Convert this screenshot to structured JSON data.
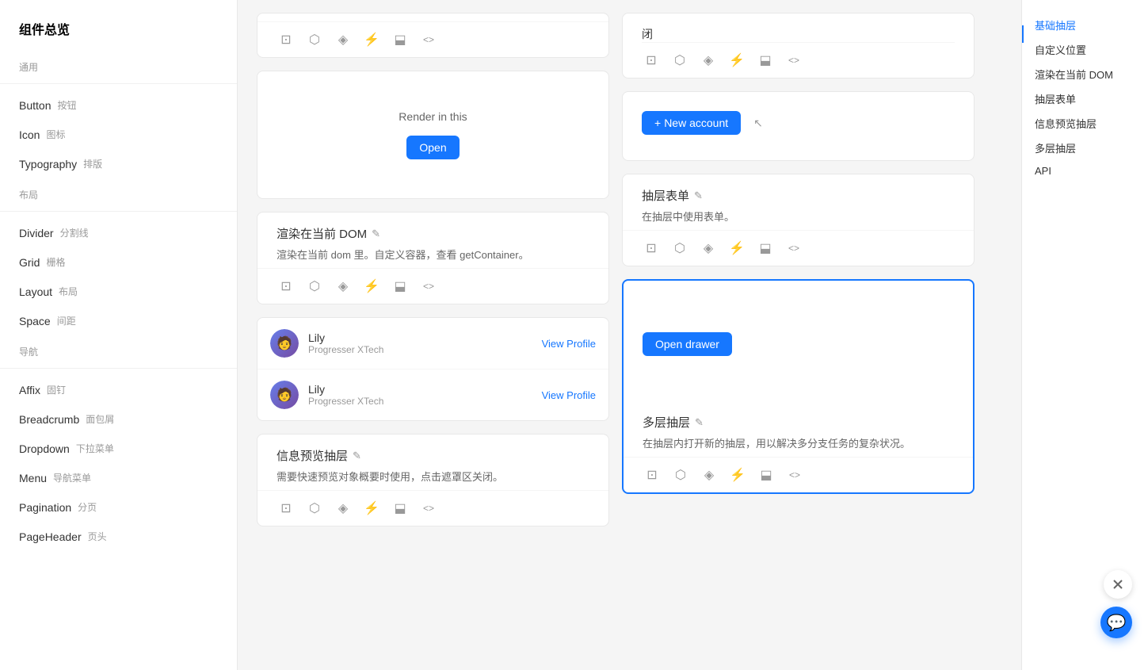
{
  "sidebar": {
    "title": "组件总览",
    "sections": [
      {
        "label": "通用",
        "items": [
          {
            "en": "Button",
            "zh": "按钮"
          },
          {
            "en": "Icon",
            "zh": "图标"
          },
          {
            "en": "Typography",
            "zh": "排版"
          }
        ]
      },
      {
        "label": "布局",
        "items": [
          {
            "en": "Divider",
            "zh": "分割线"
          },
          {
            "en": "Grid",
            "zh": "栅格"
          },
          {
            "en": "Layout",
            "zh": "布局"
          },
          {
            "en": "Space",
            "zh": "间距"
          }
        ]
      },
      {
        "label": "导航",
        "items": [
          {
            "en": "Affix",
            "zh": "固钉"
          },
          {
            "en": "Breadcrumb",
            "zh": "面包屑"
          },
          {
            "en": "Dropdown",
            "zh": "下拉菜单"
          },
          {
            "en": "Menu",
            "zh": "导航菜单"
          },
          {
            "en": "Pagination",
            "zh": "分页"
          },
          {
            "en": "PageHeader",
            "zh": "页头"
          }
        ]
      }
    ]
  },
  "main": {
    "left_column": [
      {
        "id": "render-demo",
        "demo_text": "Render in this",
        "button_label": "Open"
      },
      {
        "id": "render-dom",
        "title": "渲染在当前 DOM",
        "desc": "渲染在当前 dom 里。自定义容器，查看 getContainer。"
      },
      {
        "id": "user-list",
        "users": [
          {
            "name": "Lily",
            "company": "Progresser XTech",
            "link": "View Profile"
          },
          {
            "name": "Lily",
            "company": "Progresser XTech",
            "link": "View Profile"
          }
        ]
      },
      {
        "id": "preview-drawer",
        "title": "信息预览抽层",
        "desc": "需要快速预览对象概要时使用，点击遮罩区关闭。"
      }
    ],
    "right_column": [
      {
        "id": "close-partial",
        "text": "闭"
      },
      {
        "id": "new-account",
        "button_label": "New account",
        "button_plus": "+"
      },
      {
        "id": "form-drawer",
        "title": "抽层表单",
        "desc": "在抽层中使用表单。"
      },
      {
        "id": "multi-drawer",
        "button_label": "Open drawer",
        "title": "多层抽层",
        "desc": "在抽层内打开新的抽层，用以解决多分支任务的复杂状况。",
        "highlighted": true
      }
    ]
  },
  "right_nav": {
    "active": "基础抽层",
    "items": [
      "基础抽层",
      "自定义位置",
      "渲染在当前 DOM",
      "抽层表单",
      "信息预览抽层",
      "多层抽层",
      "API"
    ]
  },
  "icons": {
    "copy": "⊡",
    "sandbox": "⬡",
    "codepen": "◈",
    "lightning": "⚡",
    "download": "⬓",
    "code": "<>",
    "edit": "✎",
    "chat": "💬",
    "cancel": "✕"
  }
}
